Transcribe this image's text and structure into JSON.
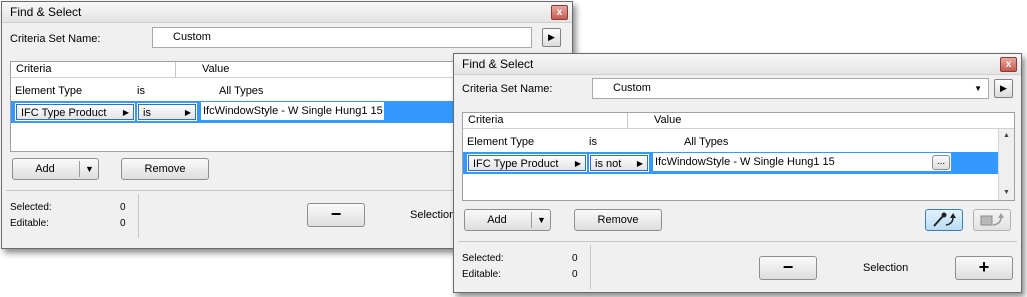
{
  "back_window": {
    "title": "Find & Select",
    "close_glyph": "x",
    "criteria_set_label": "Criteria Set Name:",
    "criteria_set_value": "Custom",
    "next_glyph": "▶",
    "table": {
      "headers": [
        "Criteria",
        "Value"
      ],
      "rows": [
        {
          "criteria": "Element Type",
          "operator": "is",
          "value": "All Types"
        },
        {
          "criteria": "IFC Type Product",
          "operator": "is",
          "value": "IfcWindowStyle - W Single Hung1 15"
        }
      ]
    },
    "add_label": "Add",
    "remove_label": "Remove",
    "selected_label": "Selected:",
    "selected_value": "0",
    "editable_label": "Editable:",
    "editable_value": "0",
    "minus_glyph": "−",
    "selection_label": "Selection"
  },
  "front_window": {
    "title": "Find & Select",
    "close_glyph": "x",
    "criteria_set_label": "Criteria Set Name:",
    "criteria_set_value": "Custom",
    "next_glyph": "▶",
    "table": {
      "headers": [
        "Criteria",
        "Value"
      ],
      "rows": [
        {
          "criteria": "Element Type",
          "operator": "is",
          "value": "All Types"
        },
        {
          "criteria": "IFC Type Product",
          "operator": "is not",
          "value": "IfcWindowStyle - W Single Hung1 15"
        }
      ]
    },
    "ellipsis_label": "...",
    "add_label": "Add",
    "remove_label": "Remove",
    "selected_label": "Selected:",
    "selected_value": "0",
    "editable_label": "Editable:",
    "editable_value": "0",
    "minus_glyph": "−",
    "plus_glyph": "+",
    "selection_label": "Selection",
    "pick_icon": "eyedropper-arrow-icon",
    "apply_icon": "parameter-transfer-icon"
  },
  "colors": {
    "selection_blue": "#3399ff",
    "window_bg": "#f0f0f0"
  }
}
